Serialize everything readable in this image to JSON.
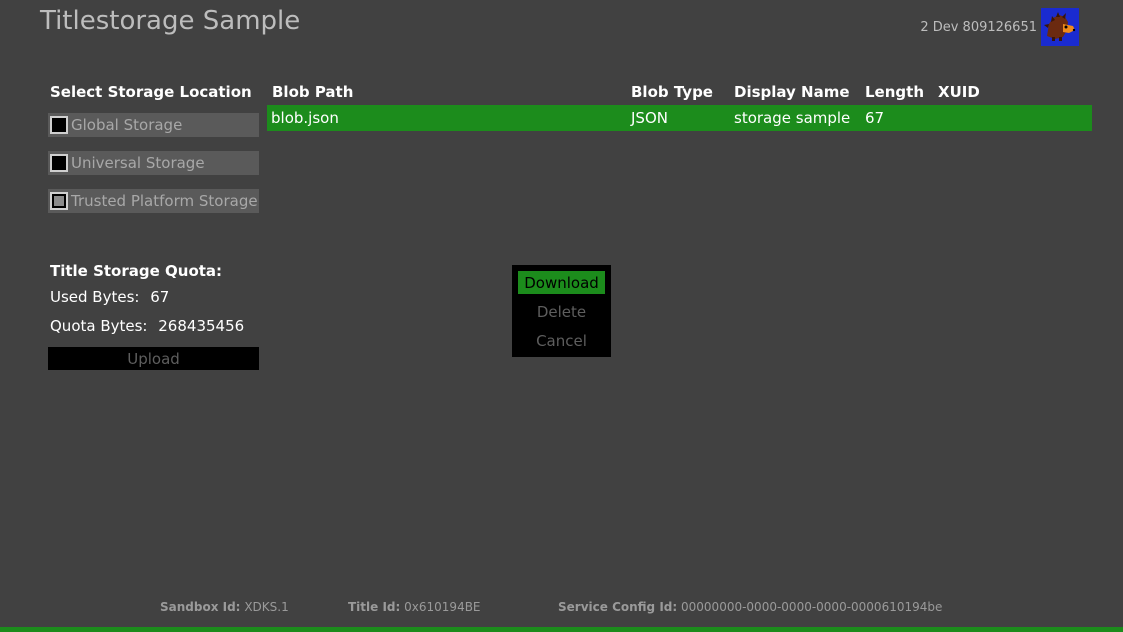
{
  "app": {
    "title": "Titlestorage Sample"
  },
  "user": {
    "gamertag": "2 Dev 809126651",
    "avatar_icon": "hedgehog-avatar-icon"
  },
  "storage": {
    "header": "Select Storage Location",
    "options": [
      {
        "label": "Global Storage",
        "checked": false
      },
      {
        "label": "Universal Storage",
        "checked": false
      },
      {
        "label": "Trusted Platform Storage",
        "checked": true
      }
    ]
  },
  "table": {
    "headers": {
      "path": "Blob Path",
      "type": "Blob Type",
      "name": "Display Name",
      "length": "Length",
      "xuid": "XUID"
    },
    "rows": [
      {
        "path": "blob.json",
        "type": "JSON",
        "name": "storage sample",
        "length": "67",
        "xuid": ""
      }
    ]
  },
  "quota": {
    "title": "Title Storage Quota:",
    "used_label": "Used Bytes:",
    "used_value": "67",
    "quota_label": "Quota Bytes:",
    "quota_value": "268435456"
  },
  "actions": {
    "upload_label": "Upload"
  },
  "context_menu": {
    "items": [
      {
        "label": "Download",
        "selected": true
      },
      {
        "label": "Delete",
        "selected": false
      },
      {
        "label": "Cancel",
        "selected": false
      }
    ]
  },
  "footer": {
    "sandbox_label": "Sandbox Id:",
    "sandbox_value": "XDKS.1",
    "title_label": "Title Id:",
    "title_value": "0x610194BE",
    "scid_label": "Service Config Id:",
    "scid_value": "00000000-0000-0000-0000-0000610194be"
  },
  "colors": {
    "background": "#414141",
    "accent": "#1c8c1c",
    "avatar_bg": "#1a2bd0"
  }
}
